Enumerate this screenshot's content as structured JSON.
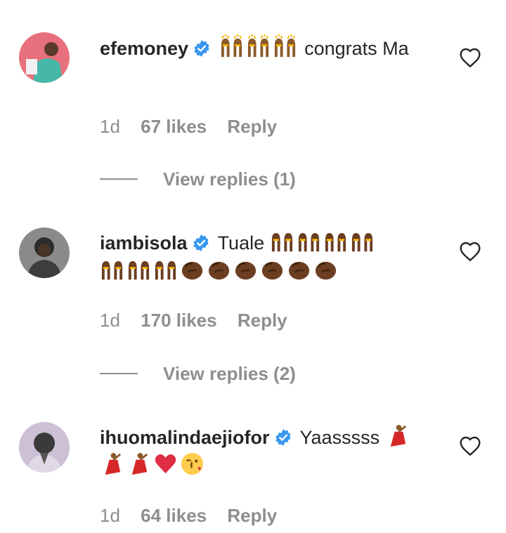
{
  "colors": {
    "username": "#262626",
    "meta": "#8e8e8e",
    "verified": "#3897f0",
    "heart_outline": "#262626"
  },
  "comments": [
    {
      "username": "efemoney",
      "verified": true,
      "avatar": "avatar-efemoney",
      "text_before": "",
      "emojis_a": [
        "raising-hands",
        "raising-hands",
        "raising-hands"
      ],
      "text_after": "congrats Ma",
      "emojis_b": [],
      "time": "1d",
      "likes": "67 likes",
      "reply": "Reply",
      "view_replies": "View replies (1)"
    },
    {
      "username": "iambisola",
      "verified": true,
      "avatar": "avatar-iambisola",
      "text_before": "Tuale",
      "emojis_a": [
        "raising-hands",
        "raising-hands",
        "raising-hands",
        "raising-hands",
        "raising-hands",
        "raising-hands",
        "raising-hands",
        "clapping-hands",
        "clapping-hands",
        "clapping-hands",
        "clapping-hands",
        "clapping-hands",
        "clapping-hands"
      ],
      "text_after": "",
      "emojis_b": [],
      "time": "1d",
      "likes": "170 likes",
      "reply": "Reply",
      "view_replies": "View replies (2)"
    },
    {
      "username": "ihuomalindaejiofor",
      "verified": true,
      "avatar": "avatar-ihuomalindaejiofor",
      "text_before": "Yaasssss",
      "emojis_a": [
        "dancer",
        "dancer",
        "dancer",
        "red-heart",
        "face-blowing-kiss"
      ],
      "text_after": "",
      "emojis_b": [],
      "time": "1d",
      "likes": "64 likes",
      "reply": "Reply",
      "view_replies": ""
    }
  ]
}
